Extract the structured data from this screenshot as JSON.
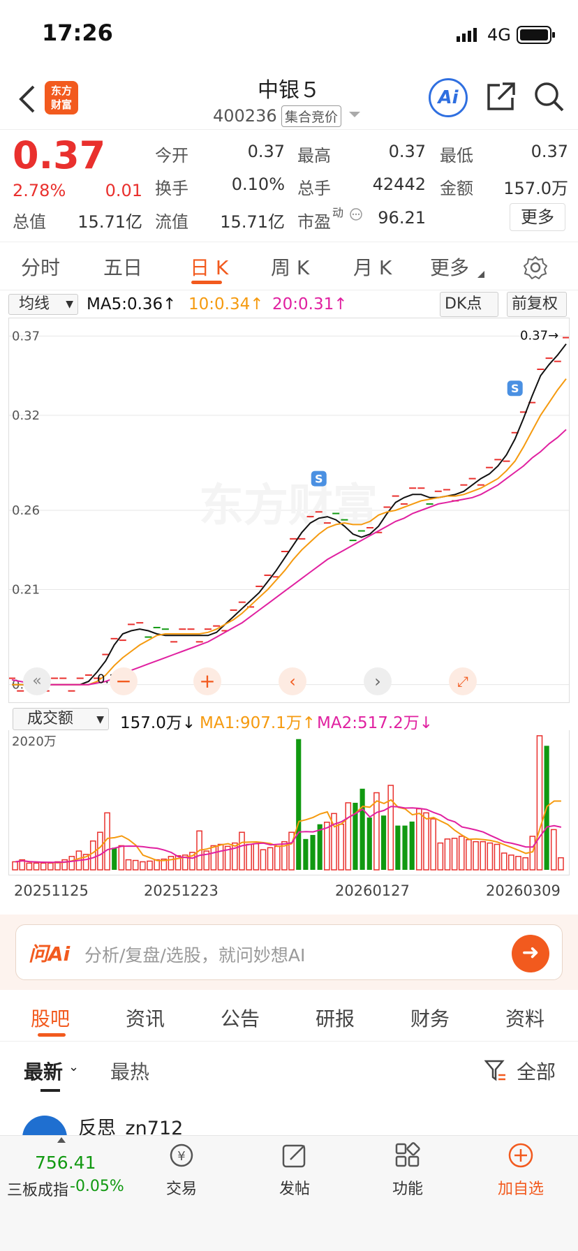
{
  "status_bar": {
    "time": "17:26",
    "network": "4G"
  },
  "nav": {
    "title": "中银５",
    "code": "400236",
    "badge": "集合竞价",
    "ai_label": "Ai",
    "logo_line1": "东方",
    "logo_line2": "财富"
  },
  "quote": {
    "price": "0.37",
    "change_pct": "2.78%",
    "change": "0.01",
    "stats": [
      {
        "label": "今开",
        "value": "0.37"
      },
      {
        "label": "最高",
        "value": "0.37"
      },
      {
        "label": "最低",
        "value": "0.37"
      },
      {
        "label": "换手",
        "value": "0.10%"
      },
      {
        "label": "总手",
        "value": "42442"
      },
      {
        "label": "金额",
        "value": "157.0万"
      }
    ],
    "total_mv_label": "总值",
    "total_mv": "15.71亿",
    "float_mv_label": "流值",
    "float_mv": "15.71亿",
    "pe_label": "市盈",
    "pe_sup": "动",
    "pe": "96.21",
    "more": "更多"
  },
  "tabs": [
    "分时",
    "五日",
    "日 K",
    "周 K",
    "月 K",
    "更多"
  ],
  "ma_bar": {
    "select": "均线",
    "ma5": "MA5:0.36↑",
    "ma10": "10:0.34↑",
    "ma20": "20:0.31↑",
    "dk": "DK点",
    "adjust": "前复权"
  },
  "colors": {
    "accent": "#f25a1e",
    "up": "#e9302d",
    "down": "#119911",
    "ma10": "#f59a0f",
    "ma20": "#e020a0",
    "ai_blue": "#2f6fe0"
  },
  "chart_data": [
    {
      "type": "line",
      "y_ticks": [
        "0.37",
        "0.32",
        "0.26",
        "0.21",
        "0.15"
      ],
      "ylim": [
        0.145,
        0.375
      ],
      "max_label": "0.37→",
      "min_label": "0.15",
      "signal_label": "S",
      "series": [
        {
          "name": "MA5",
          "values": [
            0.15,
            0.15,
            0.15,
            0.15,
            0.15,
            0.15,
            0.15,
            0.15,
            0.15,
            0.152,
            0.158,
            0.165,
            0.175,
            0.182,
            0.184,
            0.185,
            0.184,
            0.182,
            0.181,
            0.181,
            0.181,
            0.181,
            0.181,
            0.181,
            0.183,
            0.188,
            0.193,
            0.198,
            0.203,
            0.208,
            0.215,
            0.222,
            0.23,
            0.238,
            0.246,
            0.252,
            0.255,
            0.256,
            0.254,
            0.25,
            0.245,
            0.243,
            0.245,
            0.25,
            0.258,
            0.265,
            0.268,
            0.27,
            0.27,
            0.268,
            0.268,
            0.269,
            0.27,
            0.272,
            0.276,
            0.28,
            0.283,
            0.288,
            0.295,
            0.305,
            0.318,
            0.332,
            0.345,
            0.352,
            0.358,
            0.365
          ]
        },
        {
          "name": "MA10",
          "values": [
            0.15,
            0.15,
            0.15,
            0.15,
            0.15,
            0.15,
            0.15,
            0.15,
            0.15,
            0.15,
            0.152,
            0.156,
            0.162,
            0.167,
            0.171,
            0.175,
            0.178,
            0.181,
            0.182,
            0.182,
            0.182,
            0.182,
            0.182,
            0.183,
            0.185,
            0.188,
            0.191,
            0.195,
            0.2,
            0.205,
            0.21,
            0.216,
            0.222,
            0.229,
            0.235,
            0.24,
            0.245,
            0.249,
            0.251,
            0.252,
            0.251,
            0.251,
            0.253,
            0.257,
            0.259,
            0.26,
            0.262,
            0.264,
            0.266,
            0.267,
            0.268,
            0.269,
            0.269,
            0.27,
            0.272,
            0.274,
            0.277,
            0.28,
            0.285,
            0.291,
            0.3,
            0.31,
            0.32,
            0.328,
            0.336,
            0.343
          ]
        },
        {
          "name": "MA20",
          "values": [
            0.153,
            0.152,
            0.151,
            0.151,
            0.15,
            0.15,
            0.15,
            0.15,
            0.15,
            0.15,
            0.151,
            0.152,
            0.154,
            0.156,
            0.159,
            0.161,
            0.163,
            0.165,
            0.167,
            0.169,
            0.171,
            0.173,
            0.175,
            0.177,
            0.18,
            0.183,
            0.186,
            0.189,
            0.193,
            0.197,
            0.201,
            0.205,
            0.209,
            0.213,
            0.217,
            0.221,
            0.225,
            0.229,
            0.232,
            0.235,
            0.238,
            0.241,
            0.244,
            0.247,
            0.25,
            0.253,
            0.255,
            0.258,
            0.26,
            0.262,
            0.264,
            0.265,
            0.266,
            0.267,
            0.268,
            0.27,
            0.273,
            0.276,
            0.28,
            0.284,
            0.288,
            0.293,
            0.297,
            0.302,
            0.306,
            0.311
          ]
        }
      ]
    },
    {
      "type": "bar",
      "ymax_label": "2020万",
      "ylim": [
        0,
        2020
      ],
      "x_tick_labels": [
        "20251125",
        "20251223",
        "20260127",
        "20260309"
      ],
      "legend": {
        "select": "成交额",
        "value": "157.0万↓",
        "ma1": "MA1:907.1万↑",
        "ma2": "MA2:517.2万↓"
      },
      "values": [
        120,
        150,
        100,
        100,
        100,
        100,
        120,
        150,
        200,
        280,
        230,
        430,
        560,
        850,
        330,
        360,
        150,
        140,
        120,
        130,
        150,
        160,
        200,
        210,
        220,
        260,
        580,
        280,
        360,
        380,
        350,
        400,
        560,
        380,
        390,
        300,
        330,
        350,
        420,
        560,
        1950,
        460,
        520,
        680,
        710,
        840,
        680,
        1000,
        1000,
        1210,
        780,
        1150,
        810,
        1260,
        660,
        660,
        720,
        910,
        850,
        760,
        400,
        460,
        470,
        500,
        450,
        420,
        420,
        400,
        380,
        250,
        220,
        200,
        180,
        500,
        2000,
        1850,
        600,
        180
      ],
      "colors": [
        "up",
        "up",
        "up",
        "up",
        "up",
        "up",
        "up",
        "up",
        "up",
        "up",
        "up",
        "up",
        "up",
        "up",
        "down",
        "up",
        "up",
        "up",
        "up",
        "up",
        "up",
        "up",
        "up",
        "up",
        "up",
        "up",
        "up",
        "up",
        "up",
        "up",
        "up",
        "up",
        "up",
        "up",
        "up",
        "up",
        "up",
        "up",
        "up",
        "up",
        "down",
        "down",
        "down",
        "down",
        "up",
        "up",
        "up",
        "up",
        "down",
        "down",
        "down",
        "up",
        "down",
        "up",
        "down",
        "down",
        "down",
        "up",
        "up",
        "up",
        "up",
        "up",
        "up",
        "up",
        "up",
        "up",
        "up",
        "up",
        "up",
        "up",
        "up",
        "up",
        "up",
        "up",
        "up",
        "down",
        "up",
        "up"
      ]
    }
  ],
  "ai_bar": {
    "logo": "问Ai",
    "placeholder": "分析/复盘/选股，就问妙想AI"
  },
  "sub_tabs": [
    "股吧",
    "资讯",
    "公告",
    "研报",
    "财务",
    "资料"
  ],
  "filter": {
    "latest": "最新",
    "hot": "最热",
    "all": "全部"
  },
  "post": {
    "user": "反思_zn712"
  },
  "bottom_bar": {
    "index_value": "756.41",
    "index_name": "三板成指",
    "index_change": "-0.05%",
    "trade": "交易",
    "post": "发帖",
    "func": "功能",
    "add": "加自选"
  }
}
